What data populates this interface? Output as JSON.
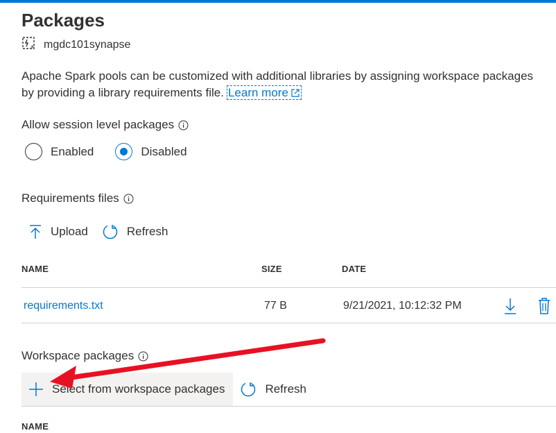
{
  "page": {
    "title": "Packages"
  },
  "resource": {
    "name": "mgdc101synapse",
    "icon": "spark-pool-icon"
  },
  "description": {
    "line1": "Apache Spark pools can be customized with additional libraries by assigning workspace packages",
    "line2": "by providing a library requirements file.",
    "learn_more": "Learn more"
  },
  "session_packages": {
    "label": "Allow session level packages",
    "options": [
      {
        "label": "Enabled",
        "selected": false
      },
      {
        "label": "Disabled",
        "selected": true
      }
    ]
  },
  "requirements": {
    "label": "Requirements files",
    "toolbar": {
      "upload": "Upload",
      "refresh": "Refresh"
    },
    "columns": {
      "name": "NAME",
      "size": "SIZE",
      "date": "DATE"
    },
    "rows": [
      {
        "name": "requirements.txt",
        "size": "77 B",
        "date": "9/21/2021, 10:12:32 PM"
      }
    ]
  },
  "workspace_packages": {
    "label": "Workspace packages",
    "toolbar": {
      "select": "Select from workspace packages",
      "refresh": "Refresh"
    },
    "columns": {
      "name": "NAME"
    }
  },
  "colors": {
    "accent": "#0078d4",
    "annotation_arrow": "#e81123",
    "text": "#323130",
    "divider": "#d2d0ce"
  }
}
